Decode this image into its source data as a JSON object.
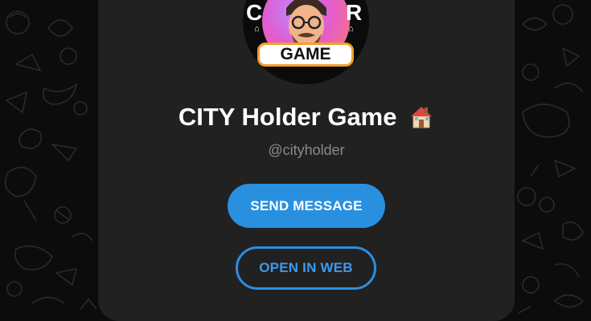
{
  "profile": {
    "name": "CITY Holder Game",
    "username": "@cityholder",
    "avatar_badge": "GAME",
    "avatar_word_left": "C",
    "avatar_word_right": "R"
  },
  "actions": {
    "send_message": "SEND MESSAGE",
    "open_in_web": "OPEN IN WEB"
  },
  "icons": {
    "name_emoji": "house-icon",
    "background": "doodle-pattern"
  },
  "colors": {
    "background": "#0c0c0c",
    "card": "#212121",
    "accent": "#2990e0",
    "text_primary": "#ffffff",
    "text_secondary": "#8b8b8b"
  }
}
